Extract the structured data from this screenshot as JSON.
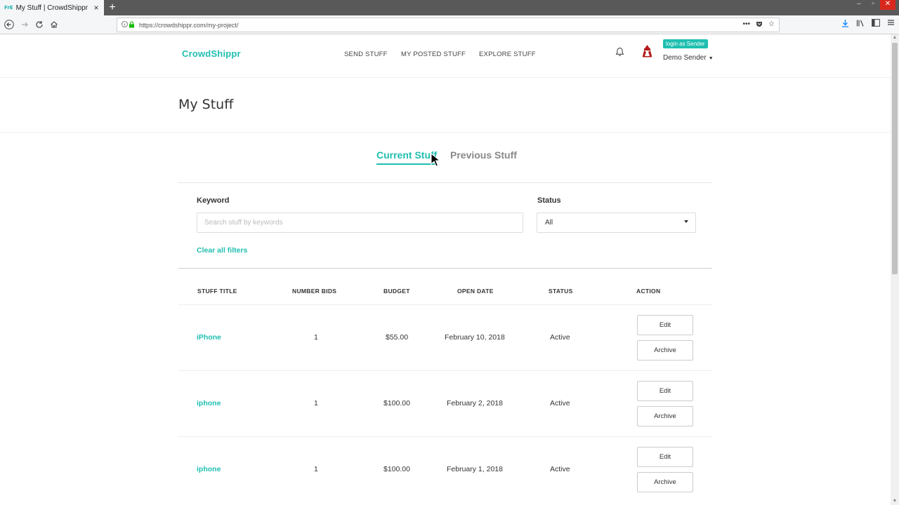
{
  "browser": {
    "tab_title": "My Stuff | CrowdShippr",
    "favicon_text": "FrE",
    "url": "https://crowdshippr.com/my-project/",
    "new_tab": "+",
    "close_tab": "×"
  },
  "header": {
    "logo": "CrowdShippr",
    "nav": [
      "SEND STUFF",
      "MY POSTED STUFF",
      "EXPLORE STUFF"
    ],
    "login_badge": "login as Sender",
    "user_name": "Demo Sender"
  },
  "page": {
    "title": "My Stuff",
    "tabs": [
      {
        "label": "Current Stuff",
        "active": true
      },
      {
        "label": "Previous Stuff",
        "active": false
      }
    ]
  },
  "filters": {
    "keyword_label": "Keyword",
    "keyword_placeholder": "Search stuff by keywords",
    "status_label": "Status",
    "status_value": "All",
    "clear_label": "Clear all filters"
  },
  "table": {
    "headers": [
      "STUFF TITLE",
      "NUMBER BIDS",
      "BUDGET",
      "OPEN DATE",
      "STATUS",
      "ACTION"
    ],
    "rows": [
      {
        "title": "iPhone",
        "bids": "1",
        "budget": "$55.00",
        "open_date": "February 10, 2018",
        "status": "Active",
        "edit": "Edit",
        "archive": "Archive"
      },
      {
        "title": "iphone",
        "bids": "1",
        "budget": "$100.00",
        "open_date": "February 2, 2018",
        "status": "Active",
        "edit": "Edit",
        "archive": "Archive"
      },
      {
        "title": "iphone",
        "bids": "1",
        "budget": "$100.00",
        "open_date": "February 1, 2018",
        "status": "Active",
        "edit": "Edit",
        "archive": "Archive"
      }
    ]
  },
  "colors": {
    "accent": "#1fbfb0",
    "text": "#333333",
    "window_close": "#d9281e"
  }
}
